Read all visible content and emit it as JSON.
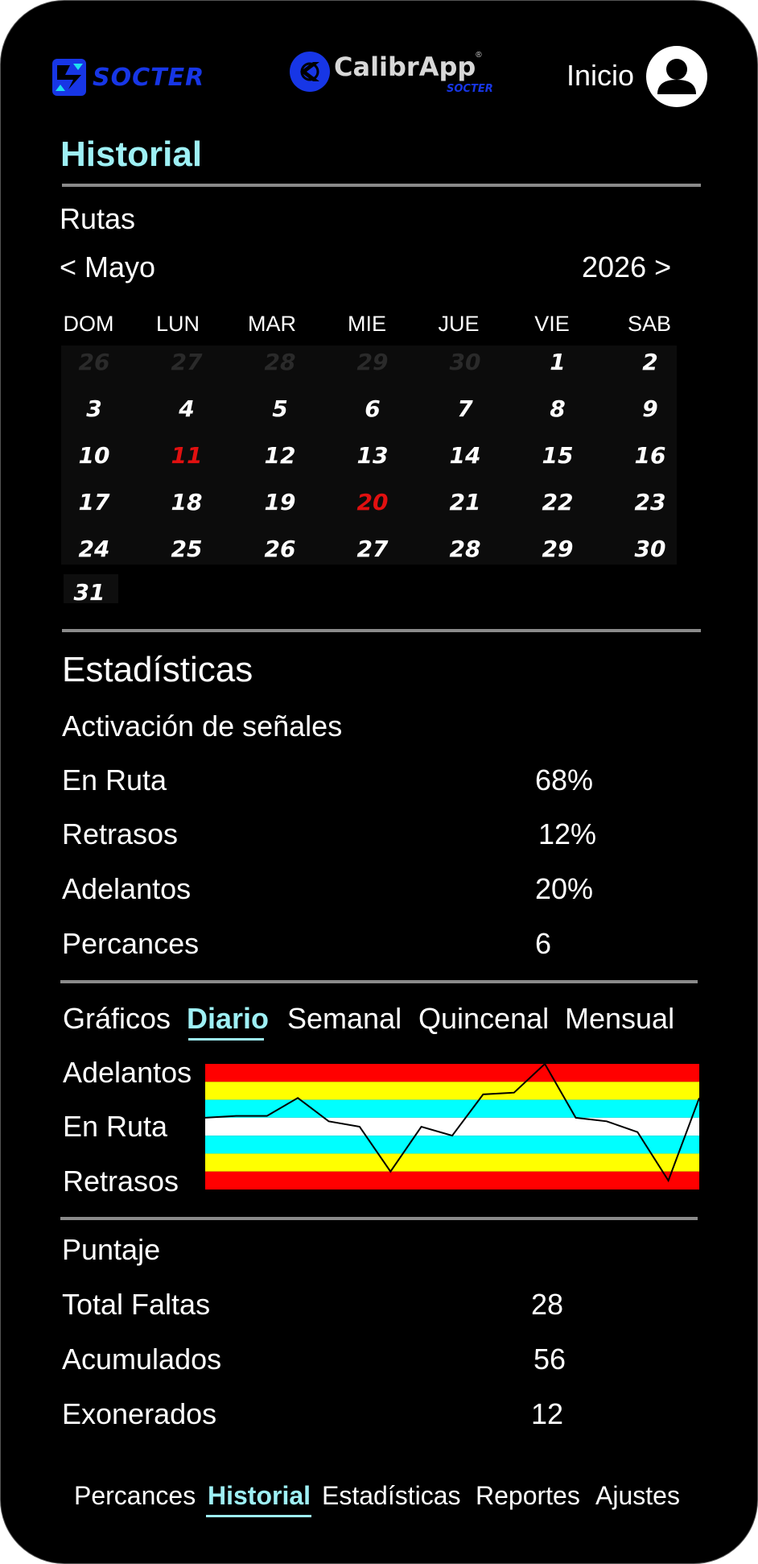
{
  "header": {
    "brand_left": "SOCTER",
    "brand_app": "CalibrApp",
    "brand_app_reg": "®",
    "brand_app_sub": "SOCTER",
    "inicio_label": "Inicio"
  },
  "page_title": "Historial",
  "rutas": {
    "label": "Rutas",
    "prev_month": "< Mayo",
    "year_next": "2026 >"
  },
  "calendar": {
    "weekdays": [
      "DOM",
      "LUN",
      "MAR",
      "MIE",
      "JUE",
      "VIE",
      "SAB"
    ],
    "rows": [
      [
        "26",
        "27",
        "28",
        "29",
        "30",
        "1",
        "2"
      ],
      [
        "3",
        "4",
        "5",
        "6",
        "7",
        "8",
        "9"
      ],
      [
        "10",
        "11",
        "12",
        "13",
        "14",
        "15",
        "16"
      ],
      [
        "17",
        "18",
        "19",
        "20",
        "21",
        "22",
        "23"
      ],
      [
        "24",
        "25",
        "26",
        "27",
        "28",
        "29",
        "30"
      ],
      [
        "31"
      ]
    ],
    "muted_days": [
      "26",
      "27",
      "28",
      "29",
      "30"
    ],
    "highlighted_days": [
      "11",
      "20"
    ],
    "highlight_color": "#e11010"
  },
  "estadisticas": {
    "title": "Estadísticas",
    "subtitle": "Activación de señales",
    "items": [
      {
        "label": "En Ruta",
        "value": "68%"
      },
      {
        "label": "Retrasos",
        "value": "12%"
      },
      {
        "label": "Adelantos",
        "value": "20%"
      },
      {
        "label": "Percances",
        "value": "6"
      }
    ]
  },
  "graficos": {
    "label": "Gráficos",
    "tabs": [
      "Diario",
      "Semanal",
      "Quincenal",
      "Mensual"
    ],
    "active_tab": "Diario",
    "band_labels": [
      "Adelantos",
      "En Ruta",
      "Retrasos"
    ]
  },
  "chart_data": {
    "type": "line",
    "bands": [
      {
        "color": "#ff0000"
      },
      {
        "color": "#ffff00"
      },
      {
        "color": "#00ffff"
      },
      {
        "color": "#ffffff"
      },
      {
        "color": "#00ffff"
      },
      {
        "color": "#ffff00"
      },
      {
        "color": "#ff0000"
      }
    ],
    "ylim": [
      -3.5,
      3.5
    ],
    "values": [
      0.5,
      0.6,
      0.6,
      1.6,
      0.3,
      0.0,
      -2.5,
      0.0,
      -0.5,
      1.8,
      1.9,
      3.5,
      0.5,
      0.3,
      -0.3,
      -3.0,
      1.6
    ]
  },
  "puntaje": {
    "title": "Puntaje",
    "items": [
      {
        "label": "Total Faltas",
        "value": "28"
      },
      {
        "label": "Acumulados",
        "value": "56"
      },
      {
        "label": "Exonerados",
        "value": "12"
      }
    ]
  },
  "bottom_nav": {
    "items": [
      "Percances",
      "Historial",
      "Estadísticas",
      "Reportes",
      "Ajustes"
    ],
    "active": "Historial"
  },
  "colors": {
    "accent": "#9ef0f5",
    "brand_blue": "#1736e6",
    "divider": "#8a8a8a"
  }
}
